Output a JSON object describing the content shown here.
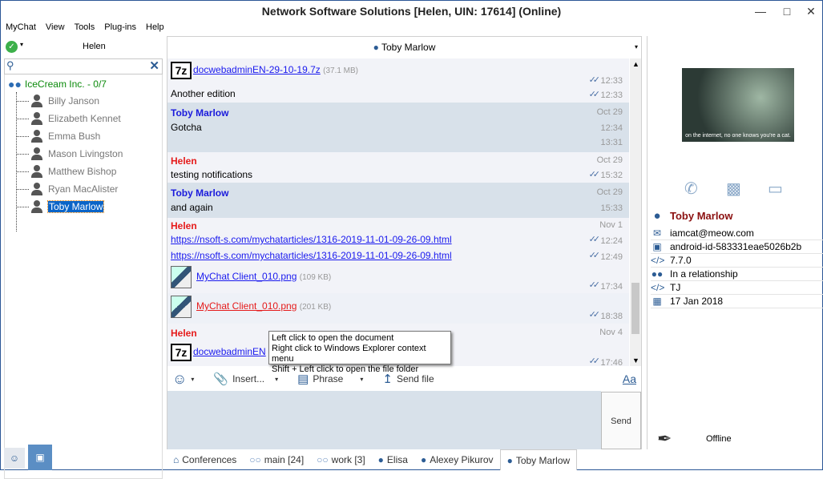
{
  "window": {
    "title": "Network Software Solutions [Helen, UIN: 17614] (Online)"
  },
  "menu": [
    "MyChat",
    "View",
    "Tools",
    "Plug-ins",
    "Help"
  ],
  "left": {
    "current_user": "Helen",
    "group": "IceCream Inc. - 0/7",
    "users": [
      "Billy Janson",
      "Elizabeth Kennet",
      "Emma Bush",
      "Mason Livingston",
      "Matthew Bishop",
      "Ryan MacAlister",
      "Toby Marlow"
    ],
    "selected": "Toby Marlow"
  },
  "chat": {
    "header": "Toby Marlow",
    "m1": {
      "file": "docwebadminEN-29-10-19.7z",
      "size": "(37.1 MB)",
      "t1": "12:33",
      "text": "Another edition",
      "t2": "12:33"
    },
    "m2": {
      "author": "Toby Marlow",
      "date": "Oct 29",
      "text": "Gotcha",
      "t1": "12:34",
      "t2": "13:31"
    },
    "m3": {
      "author": "Helen",
      "date": "Oct 29",
      "text": "testing notifications",
      "t1": "15:32"
    },
    "m4": {
      "author": "Toby Marlow",
      "date": "Oct 29",
      "text": "and again",
      "t1": "15:33"
    },
    "m5": {
      "author": "Helen",
      "date": "Nov 1",
      "link1": "https://nsoft-s.com/mychatarticles/1316-2019-11-01-09-26-09.html",
      "t1": "12:24",
      "link2": "https://nsoft-s.com/mychatarticles/1316-2019-11-01-09-26-09.html",
      "t2": "12:49",
      "file1": "MyChat Client_010.png",
      "size1": "(109 KB)",
      "t3": "17:34",
      "file2": "MyChat Client_010.png",
      "size2": "(201 KB)",
      "t4": "18:38"
    },
    "m6": {
      "author": "Helen",
      "date": "Nov 4",
      "file": "docwebadminEN",
      "t1": "17:46"
    },
    "tooltip": [
      "Left click to open the document",
      "Right click to Windows Explorer context menu",
      "Shift + Left click to open the file folder"
    ]
  },
  "toolbar": {
    "insert": "Insert...",
    "phrase": "Phrase",
    "send_file": "Send file",
    "font": "Aa",
    "send": "Send"
  },
  "tabs": [
    "Conferences",
    "main [24]",
    "work [3]",
    "Elisa",
    "Alexey Pikurov",
    "Toby Marlow"
  ],
  "profile": {
    "photo_caption": "on the internet, no one knows you're a cat.",
    "name": "Toby Marlow",
    "email": "iamcat@meow.com",
    "device": "android-id-583331eae5026b2b",
    "version": "7.7.0",
    "relationship": "In a relationship",
    "nick": "TJ",
    "date": "17 Jan 2018",
    "status": "Offline"
  },
  "colors": {
    "accent": "#0a64c8",
    "toby": "#1a1adc",
    "helen": "#e51a1a",
    "chat_alt": "#d8e1ea"
  }
}
